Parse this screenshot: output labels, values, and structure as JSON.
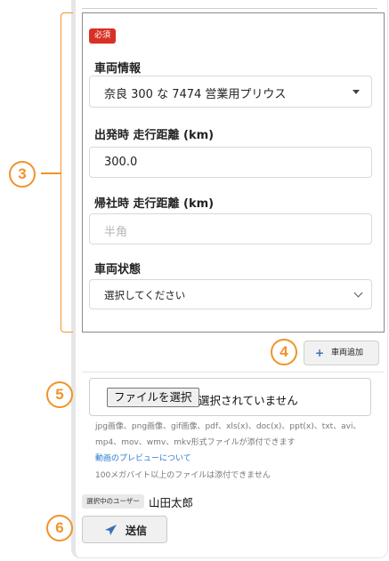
{
  "callouts": {
    "c3": "3",
    "c4": "4",
    "c5": "5",
    "c6": "6"
  },
  "vehicle_form": {
    "required_badge": "必須",
    "vehicle_info_label": "車両情報",
    "vehicle_select_value": "奈良 300 な 7474 営業用プリウス",
    "departure_km_label": "出発時 走行距離 (km)",
    "departure_km_value": "300.0",
    "return_km_label": "帰社時 走行距離 (km)",
    "return_km_placeholder": "半角",
    "condition_label": "車両状態",
    "condition_select_value": "選択してください"
  },
  "add_vehicle": {
    "plus": "+",
    "label": "車両追加"
  },
  "file_upload": {
    "choose_button": "ファイルを選択",
    "no_file_text": "選択されていません",
    "help_line1": "jpg画像、png画像、gif画像、pdf、xls(x)、doc(x)、ppt(x)、txt、avi、",
    "help_line2": "mp4、mov、wmv、mkv形式ファイルが添付できます",
    "preview_link": "動画のプレビューについて",
    "size_limit": "100メガバイト以上のファイルは添付できません"
  },
  "user": {
    "badge": "選択中のユーザー",
    "name": "山田太郎"
  },
  "submit": {
    "label": "送信",
    "icon": "paper-plane-icon"
  },
  "colors": {
    "accent": "#f0932b",
    "required": "#d93025",
    "link": "#2a7bd3",
    "send_icon": "#3d6eb4"
  }
}
